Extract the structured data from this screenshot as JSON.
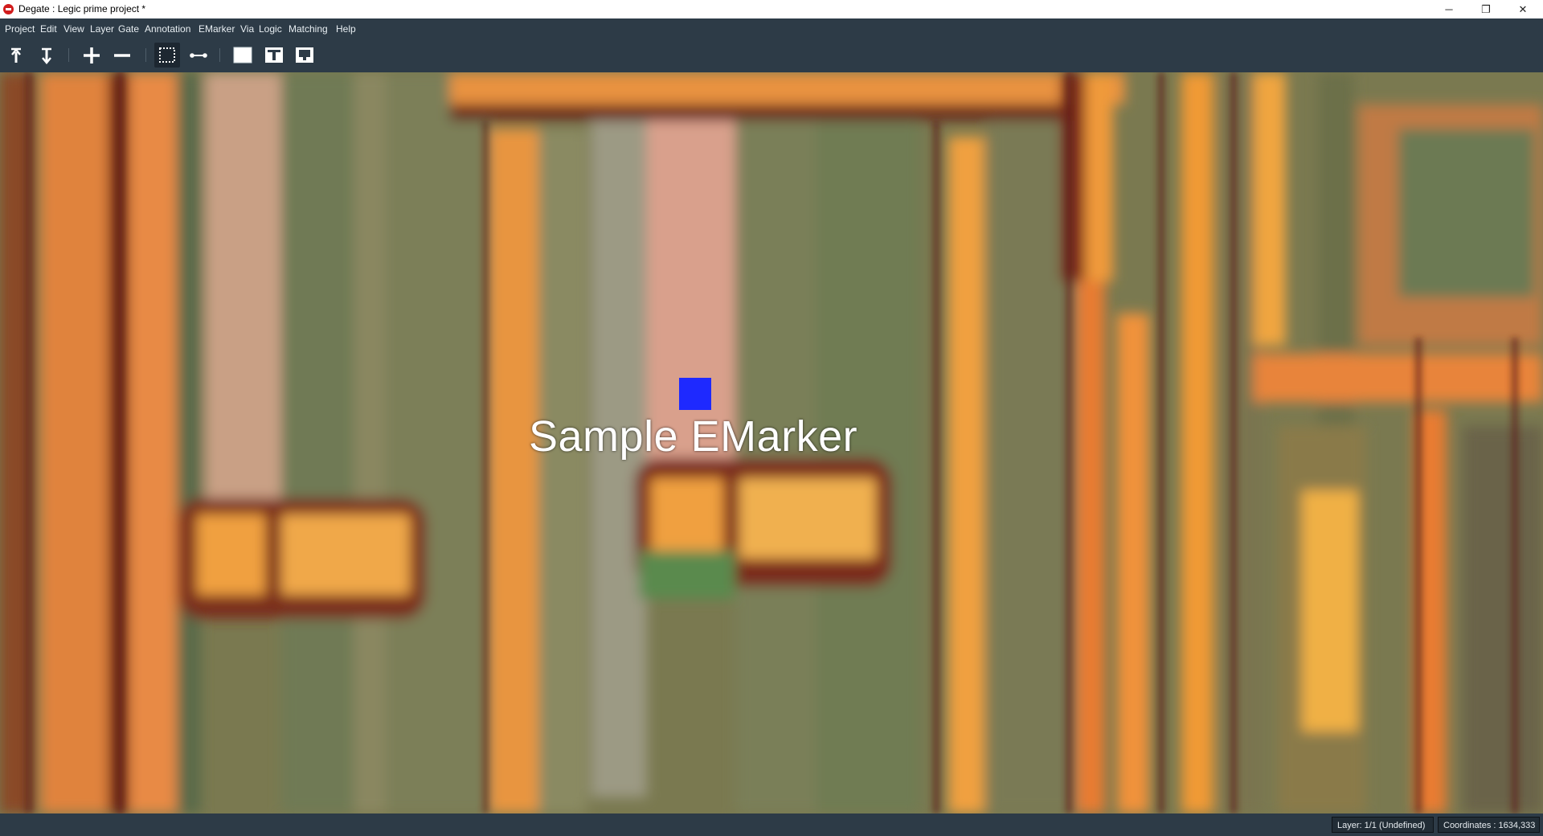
{
  "window": {
    "title": "Degate : Legic prime project *",
    "minimize_glyph": "─",
    "maximize_glyph": "❐",
    "close_glyph": "✕"
  },
  "menu": [
    {
      "label": "Project"
    },
    {
      "label": "Edit"
    },
    {
      "label": "View"
    },
    {
      "label": "Layer"
    },
    {
      "label": "Gate"
    },
    {
      "label": "Annotation"
    },
    {
      "label": "EMarker"
    },
    {
      "label": "Via"
    },
    {
      "label": "Logic"
    },
    {
      "label": "Matching"
    },
    {
      "label": "Help"
    }
  ],
  "toolbar": [
    {
      "icon": "layer-up-icon"
    },
    {
      "icon": "layer-down-icon"
    },
    {
      "icon": "zoom-in-icon"
    },
    {
      "icon": "zoom-out-icon"
    },
    {
      "icon": "area-select-icon",
      "active": true
    },
    {
      "icon": "wire-tool-icon"
    },
    {
      "icon": "background-layer-icon"
    },
    {
      "icon": "metal-layer-icon"
    },
    {
      "icon": "logic-layer-icon"
    }
  ],
  "canvas": {
    "emarker": {
      "label": "Sample EMarker",
      "color": "#1e29ff"
    }
  },
  "status": {
    "layer": "Layer: 1/1 (Undefined)",
    "coordinates": "Coordinates : 1634,333"
  },
  "colors": {
    "chrome": "#2d3b47",
    "status_box": "#222d36",
    "emarker": "#1e29ff"
  }
}
